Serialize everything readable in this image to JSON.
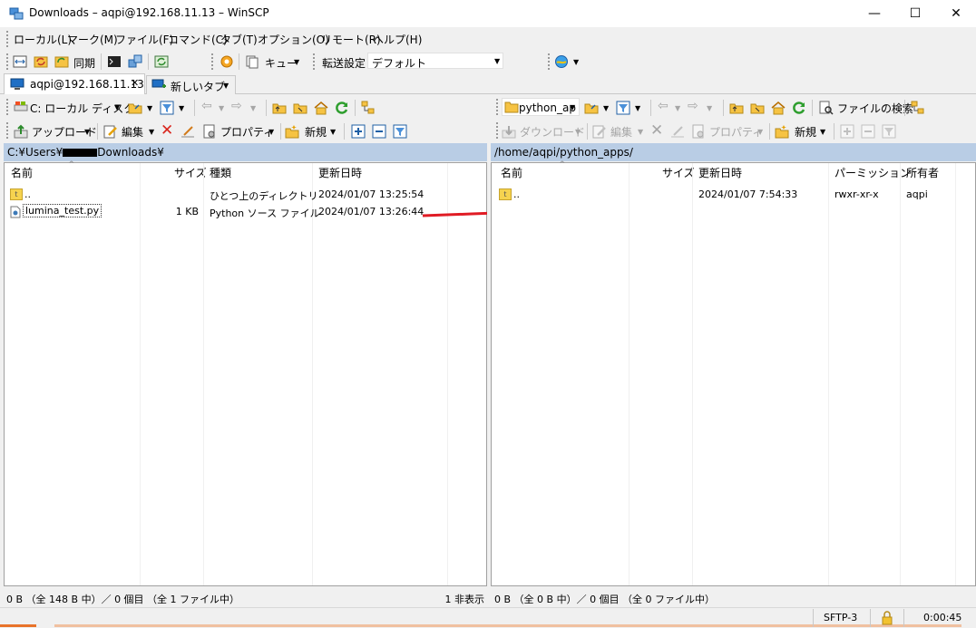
{
  "window": {
    "title": "Downloads – aqpi@192.168.11.13 – WinSCP",
    "minimize_glyph": "—",
    "maximize_glyph": "☐",
    "close_glyph": "✕"
  },
  "menu": [
    "ローカル(L)",
    "マーク(M)",
    "ファイル(F)",
    "コマンド(C)",
    "タブ(T)",
    "オプション(O)",
    "リモート(R)",
    "ヘルプ(H)"
  ],
  "toolbar": {
    "sync_label": "同期",
    "queue_label": "キュー",
    "transfer_settings_label": "転送設定",
    "transfer_preset": "デフォルト"
  },
  "tabs": {
    "session_tab": "aqpi@192.168.11.13",
    "session_close": "✕",
    "new_tab": "新しいタブ"
  },
  "local": {
    "drive": "C: ローカル ディスク",
    "upload_label": "アップロード",
    "edit_label": "編集",
    "properties_label": "プロパティ",
    "new_label": "新規",
    "path": "C:¥Users¥",
    "path_tail": "Downloads¥",
    "columns": {
      "name": "名前",
      "size": "サイズ",
      "type": "種類",
      "modified": "更新日時"
    },
    "rows": [
      {
        "name": "..",
        "size": "",
        "type": "ひとつ上のディレクトリ",
        "modified": "2024/01/07 13:25:54"
      },
      {
        "name": "lumina_test.py",
        "size": "1 KB",
        "type": "Python ソース ファイル",
        "modified": "2024/01/07 13:26:44"
      }
    ],
    "status": "0 B （全 148 B 中）／ 0 個目 （全 1 ファイル中）",
    "hidden": "1 非表示"
  },
  "remote": {
    "folder": "python_ap",
    "find_files_label": "ファイルの検索",
    "download_label": "ダウンロード",
    "edit_label": "編集",
    "properties_label": "プロパティ",
    "new_label": "新規",
    "path": "/home/aqpi/python_apps/",
    "columns": {
      "name": "名前",
      "size": "サイズ",
      "modified": "更新日時",
      "permissions": "パーミッション",
      "owner": "所有者"
    },
    "rows": [
      {
        "name": "..",
        "size": "",
        "modified": "2024/01/07 7:54:33",
        "permissions": "rwxr-xr-x",
        "owner": "aqpi"
      }
    ],
    "status": "0 B （全 0 B 中）／ 0 個目 （全 0 ファイル中）"
  },
  "statusbar": {
    "protocol": "SFTP-3",
    "elapsed": "0:00:45"
  },
  "colors": {
    "path_bar": "#b9cde5",
    "arrow": "#e01b24"
  }
}
